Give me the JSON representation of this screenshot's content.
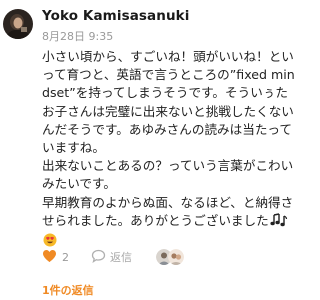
{
  "comment": {
    "author": "Yoko Kamisasanuki",
    "timestamp": "8月28日 9:35",
    "text": "小さい頃から、すごいね！頭がいいね！といって育つと、英語で言うところの”fixed mindset”を持ってしまうそうです。そういぅたお子さんは完璧に出来ないと挑戦したくないんだそうです。あゆみさんの読みは当たっていますね。\n出来ないことあるの？っていう言葉がこわいみたいです。\n早期教育のよからぬ面、なるほど、と納得させられました。ありがとうございました",
    "trailing_emojis": [
      "musical-notes-icon",
      "heart-eyes-emoji-icon"
    ]
  },
  "actions": {
    "like_icon": "heart-icon",
    "like_count": "2",
    "reply_icon": "speech-bubble-icon",
    "reply_label": "返信",
    "liker_avatars": [
      "liker-avatar-1",
      "liker-avatar-2"
    ]
  },
  "replies": {
    "label": "1件の返信"
  },
  "colors": {
    "accent": "#f08a24",
    "muted_text": "#9a9a9a",
    "body_text": "#222222"
  }
}
